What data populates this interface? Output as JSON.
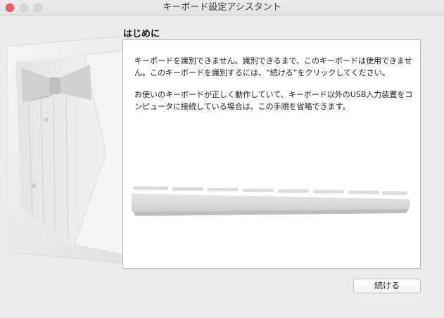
{
  "window": {
    "title": "キーボード設定アシスタント"
  },
  "page": {
    "heading": "はじめに",
    "paragraph1": "キーボードを識別できません。識別できるまで、このキーボードは使用できません。このキーボードを識別するには、“続ける”をクリックしてください。",
    "paragraph2": "お使いのキーボードが正しく動作していて、キーボード以外のUSB入力装置をコンピュータに接続している場合は、この手順を省略できます。"
  },
  "buttons": {
    "continue_label": "続ける"
  },
  "icons": {
    "illustration": "tuxedo-illustration",
    "keyboard": "keyboard-image"
  },
  "colors": {
    "close": "#fc5b57",
    "window_bg": "#ececec",
    "content_bg": "#ffffff"
  }
}
